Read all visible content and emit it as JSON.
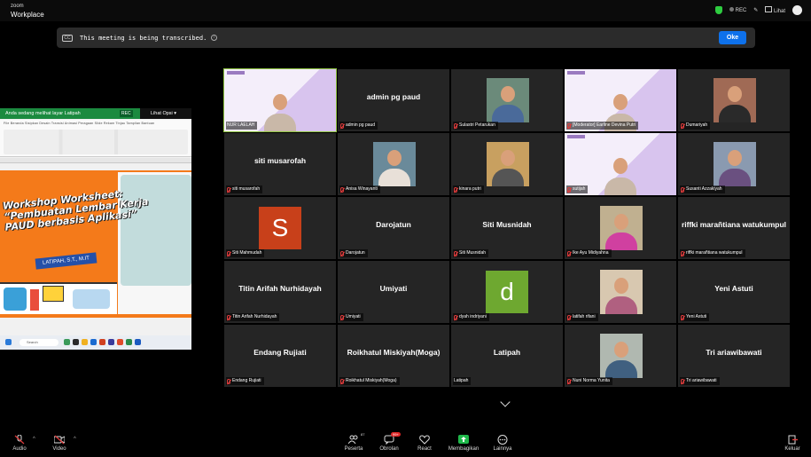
{
  "app": {
    "brand_line1": "zoom",
    "brand_line2": "Workplace"
  },
  "topbar": {
    "rec_label": "REC",
    "view_label": "Lihat"
  },
  "banner": {
    "text": "This meeting is being transcribed.",
    "ok_label": "Oke"
  },
  "share": {
    "notice": "Anda sedang melihat layar  Latipah",
    "rec": "REC",
    "options_label": "Lihat Opsi",
    "ribbon_tabs": "File   Beranda   Sisipkan   Desain   Transisi   Animasi   Peragaan Slide   Rekam   Tinjau   Tampilan   Bantuan",
    "slide_title": "Workshop Worksheet: “Pembuatan Lembar Kerja PAUD berbasis Aplikasi”",
    "slide_author": "LATIPAH, S.T., M.IT",
    "taskbar_search": "Search"
  },
  "participants": [
    {
      "label": "NUR LAELAH",
      "name": "",
      "type": "card",
      "muted": false,
      "active": true
    },
    {
      "label": "admin pg paud",
      "name": "admin pg paud",
      "type": "name",
      "muted": true
    },
    {
      "label": "Sulastri Petarukan",
      "name": "",
      "type": "photo",
      "muted": true,
      "bg": "#6b8a7a",
      "shirt": "#4a6a9a"
    },
    {
      "label": "[Moderator] Earline Devina Putri",
      "name": "",
      "type": "card",
      "muted": true
    },
    {
      "label": "Dumariyah",
      "name": "",
      "type": "photo",
      "muted": true,
      "bg": "#a06a55",
      "shirt": "#2a2a2a"
    },
    {
      "label": "siti musarofah",
      "name": "siti musarofah",
      "type": "name",
      "muted": true
    },
    {
      "label": "Anisa Winayanti",
      "name": "",
      "type": "photo",
      "muted": true,
      "bg": "#6a8a9a",
      "shirt": "#e8e0d8"
    },
    {
      "label": "kinara putri",
      "name": "",
      "type": "photo",
      "muted": true,
      "bg": "#c8a060",
      "shirt": "#555"
    },
    {
      "label": "sutijah",
      "name": "",
      "type": "card",
      "muted": true
    },
    {
      "label": "Susanti Azzakiyah",
      "name": "",
      "type": "photo",
      "muted": true,
      "bg": "#8a9ab0",
      "shirt": "#6a5080"
    },
    {
      "label": "Siti Mahmudah",
      "name": "",
      "type": "initial",
      "initial": "S",
      "color": "#c8401a",
      "muted": true
    },
    {
      "label": "Darojatun",
      "name": "Darojatun",
      "type": "name",
      "muted": true
    },
    {
      "label": "Siti Musnidah",
      "name": "Siti Musnidah",
      "type": "name",
      "muted": true
    },
    {
      "label": "Ike Ayu Midiyahna",
      "name": "",
      "type": "photo",
      "muted": true,
      "bg": "#c0b090",
      "shirt": "#d040a0"
    },
    {
      "label": "riffki marañtiana watukumpul",
      "name": "riffki marañtiana watukumpul",
      "type": "name",
      "muted": true
    },
    {
      "label": "Titin Arifah Nurhidayah",
      "name": "Titin Arifah Nurhidayah",
      "type": "name",
      "muted": true
    },
    {
      "label": "Umiyati",
      "name": "Umiyati",
      "type": "name",
      "muted": true
    },
    {
      "label": "dyah indriyani",
      "name": "",
      "type": "initial",
      "initial": "d",
      "color": "#6ea830",
      "muted": true
    },
    {
      "label": "latifah rifani",
      "name": "",
      "type": "photo",
      "muted": true,
      "bg": "#d8c8b0",
      "shirt": "#b06080"
    },
    {
      "label": "Yeni Astuti",
      "name": "Yeni Astuti",
      "type": "name",
      "muted": true
    },
    {
      "label": "Endang Rujiati",
      "name": "Endang Rujiati",
      "type": "name",
      "muted": true
    },
    {
      "label": "Roikhatul Miskiyah(Moga)",
      "name": "Roikhatul Miskiyah(Moga)",
      "type": "name",
      "muted": true
    },
    {
      "label": "Latipah",
      "name": "Latipah",
      "type": "name",
      "muted": false
    },
    {
      "label": "Nuni Norma Yunita",
      "name": "",
      "type": "photo",
      "muted": true,
      "bg": "#b0b8b0",
      "shirt": "#406080"
    },
    {
      "label": "Tri ariawibawati",
      "name": "Tri ariawibawati",
      "type": "name",
      "muted": true
    }
  ],
  "toolbar": {
    "audio": "Audio",
    "video": "Video",
    "participants": "Peserta",
    "participants_count": "87",
    "chat": "Obrolan",
    "chat_badge": "99+",
    "react": "React",
    "share": "Membagikan",
    "more": "Lainnya",
    "leave": "Keluar"
  },
  "colors": {
    "accent": "#0e71eb",
    "share_green": "#1b8a3f",
    "muted_red": "#e03c3c",
    "tile_bg": "#252525"
  }
}
